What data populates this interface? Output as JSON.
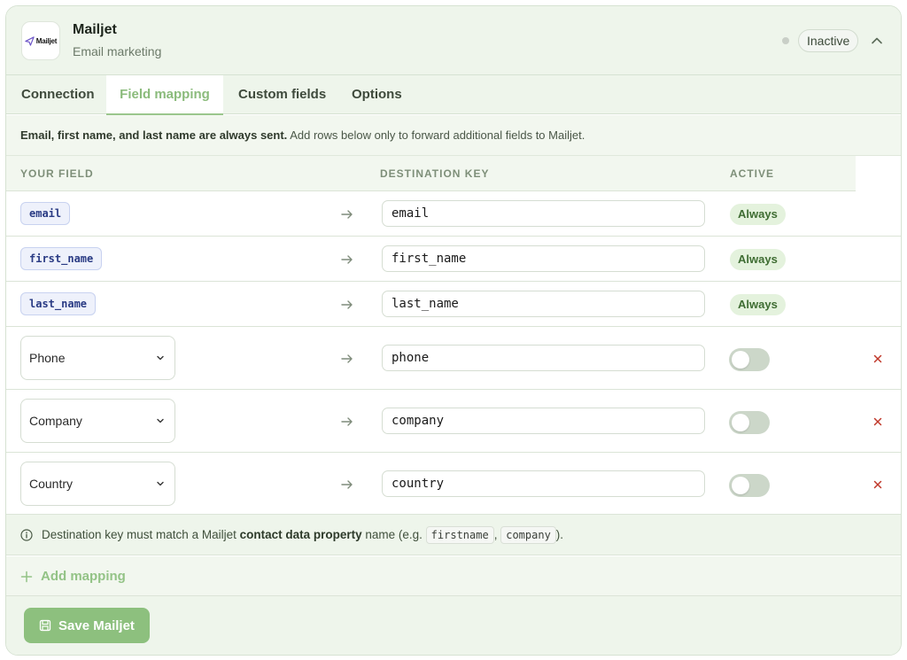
{
  "integration": {
    "name": "Mailjet",
    "subtitle": "Email marketing",
    "status": "Inactive",
    "logo_text": "Mailjet"
  },
  "tabs": [
    {
      "label": "Connection"
    },
    {
      "label": "Field mapping"
    },
    {
      "label": "Custom fields"
    },
    {
      "label": "Options"
    }
  ],
  "info": {
    "bold": "Email, first name, and last name are always sent.",
    "rest": " Add rows below only to forward additional fields to Mailjet."
  },
  "table": {
    "headers": [
      "YOUR FIELD",
      "DESTINATION KEY",
      "ACTIVE"
    ],
    "fixed_rows": [
      {
        "field": "email",
        "destination": "email",
        "active": "Always"
      },
      {
        "field": "first_name",
        "destination": "first_name",
        "active": "Always"
      },
      {
        "field": "last_name",
        "destination": "last_name",
        "active": "Always"
      }
    ],
    "custom_rows": [
      {
        "field": "Phone",
        "destination": "phone",
        "active": false
      },
      {
        "field": "Company",
        "destination": "company",
        "active": false
      },
      {
        "field": "Country",
        "destination": "country",
        "active": false
      }
    ]
  },
  "note": {
    "prefix": "Destination key must match a Mailjet ",
    "bold": "contact data property",
    "middle": " name (e.g. ",
    "example1": "firstname",
    "sep": ", ",
    "example2": "company",
    "suffix": ")."
  },
  "add_mapping_label": "Add mapping",
  "save_label": "Save Mailjet",
  "colors": {
    "accent": "#8dc07e",
    "chip_text": "#2a3b84",
    "remove": "#c0392b"
  }
}
